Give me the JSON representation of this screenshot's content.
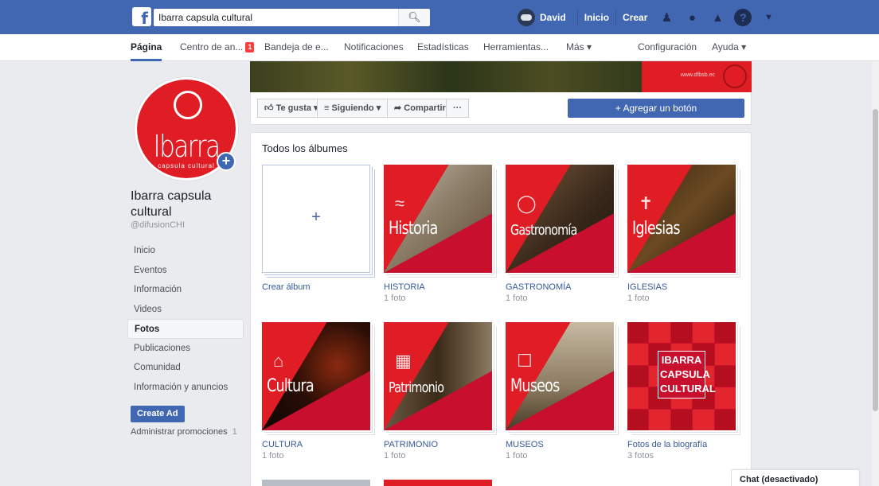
{
  "topbar": {
    "search_value": "Ibarra capsula cultural",
    "profile_name": "David",
    "home_label": "Inicio",
    "create_label": "Crear"
  },
  "pagenav": {
    "items": [
      {
        "label": "Página"
      },
      {
        "label": "Centro de an..."
      },
      {
        "label": "Bandeja de e..."
      },
      {
        "label": "Notificaciones"
      },
      {
        "label": "Estadísticas"
      },
      {
        "label": "Herramientas..."
      },
      {
        "label": "Más ▾"
      },
      {
        "label": "Configuración"
      },
      {
        "label": "Ayuda ▾"
      }
    ],
    "badge_count": "1"
  },
  "profile": {
    "name": "Ibarra capsula cultural",
    "handle": "@difusionCHI",
    "logo_text": "Ibarra",
    "logo_sub": "capsula cultural"
  },
  "leftnav": {
    "items": [
      {
        "label": "Inicio"
      },
      {
        "label": "Eventos"
      },
      {
        "label": "Información"
      },
      {
        "label": "Videos"
      },
      {
        "label": "Fotos"
      },
      {
        "label": "Publicaciones"
      },
      {
        "label": "Comunidad"
      },
      {
        "label": "Información y anuncios"
      }
    ],
    "create_ad": "Create Ad",
    "promotions": "Administrar promociones",
    "promotions_count": "1"
  },
  "cover": {
    "url_text": "www.dfbsb.ec"
  },
  "actions": {
    "like": "Te gusta ▾",
    "following": "Siguiendo ▾",
    "share": "Compartir",
    "more": "···",
    "add_button": "+ Agregar un botón"
  },
  "albums": {
    "title": "Todos los álbumes",
    "create_label": "Crear álbum",
    "items": [
      {
        "name": "HISTORIA",
        "count": "1 foto",
        "cover_word": "Historia"
      },
      {
        "name": "GASTRONOMÍA",
        "count": "1 foto",
        "cover_word": "Gastronomía"
      },
      {
        "name": "IGLESIAS",
        "count": "1 foto",
        "cover_word": "Iglesias"
      },
      {
        "name": "CULTURA",
        "count": "1 foto",
        "cover_word": "Cultura"
      },
      {
        "name": "PATRIMONIO",
        "count": "1 foto",
        "cover_word": "Patrimonio"
      },
      {
        "name": "MUSEOS",
        "count": "1 foto",
        "cover_word": "Museos"
      },
      {
        "name": "Fotos de la biografía",
        "count": "3 fotos",
        "cover_word": "IBARRA CAPSULA CULTURAL"
      }
    ]
  },
  "chat": {
    "label": "Chat (desactivado)"
  },
  "colors": {
    "facebook_blue": "#4267b2",
    "brand_red": "#e01c24",
    "link_blue": "#365899"
  }
}
